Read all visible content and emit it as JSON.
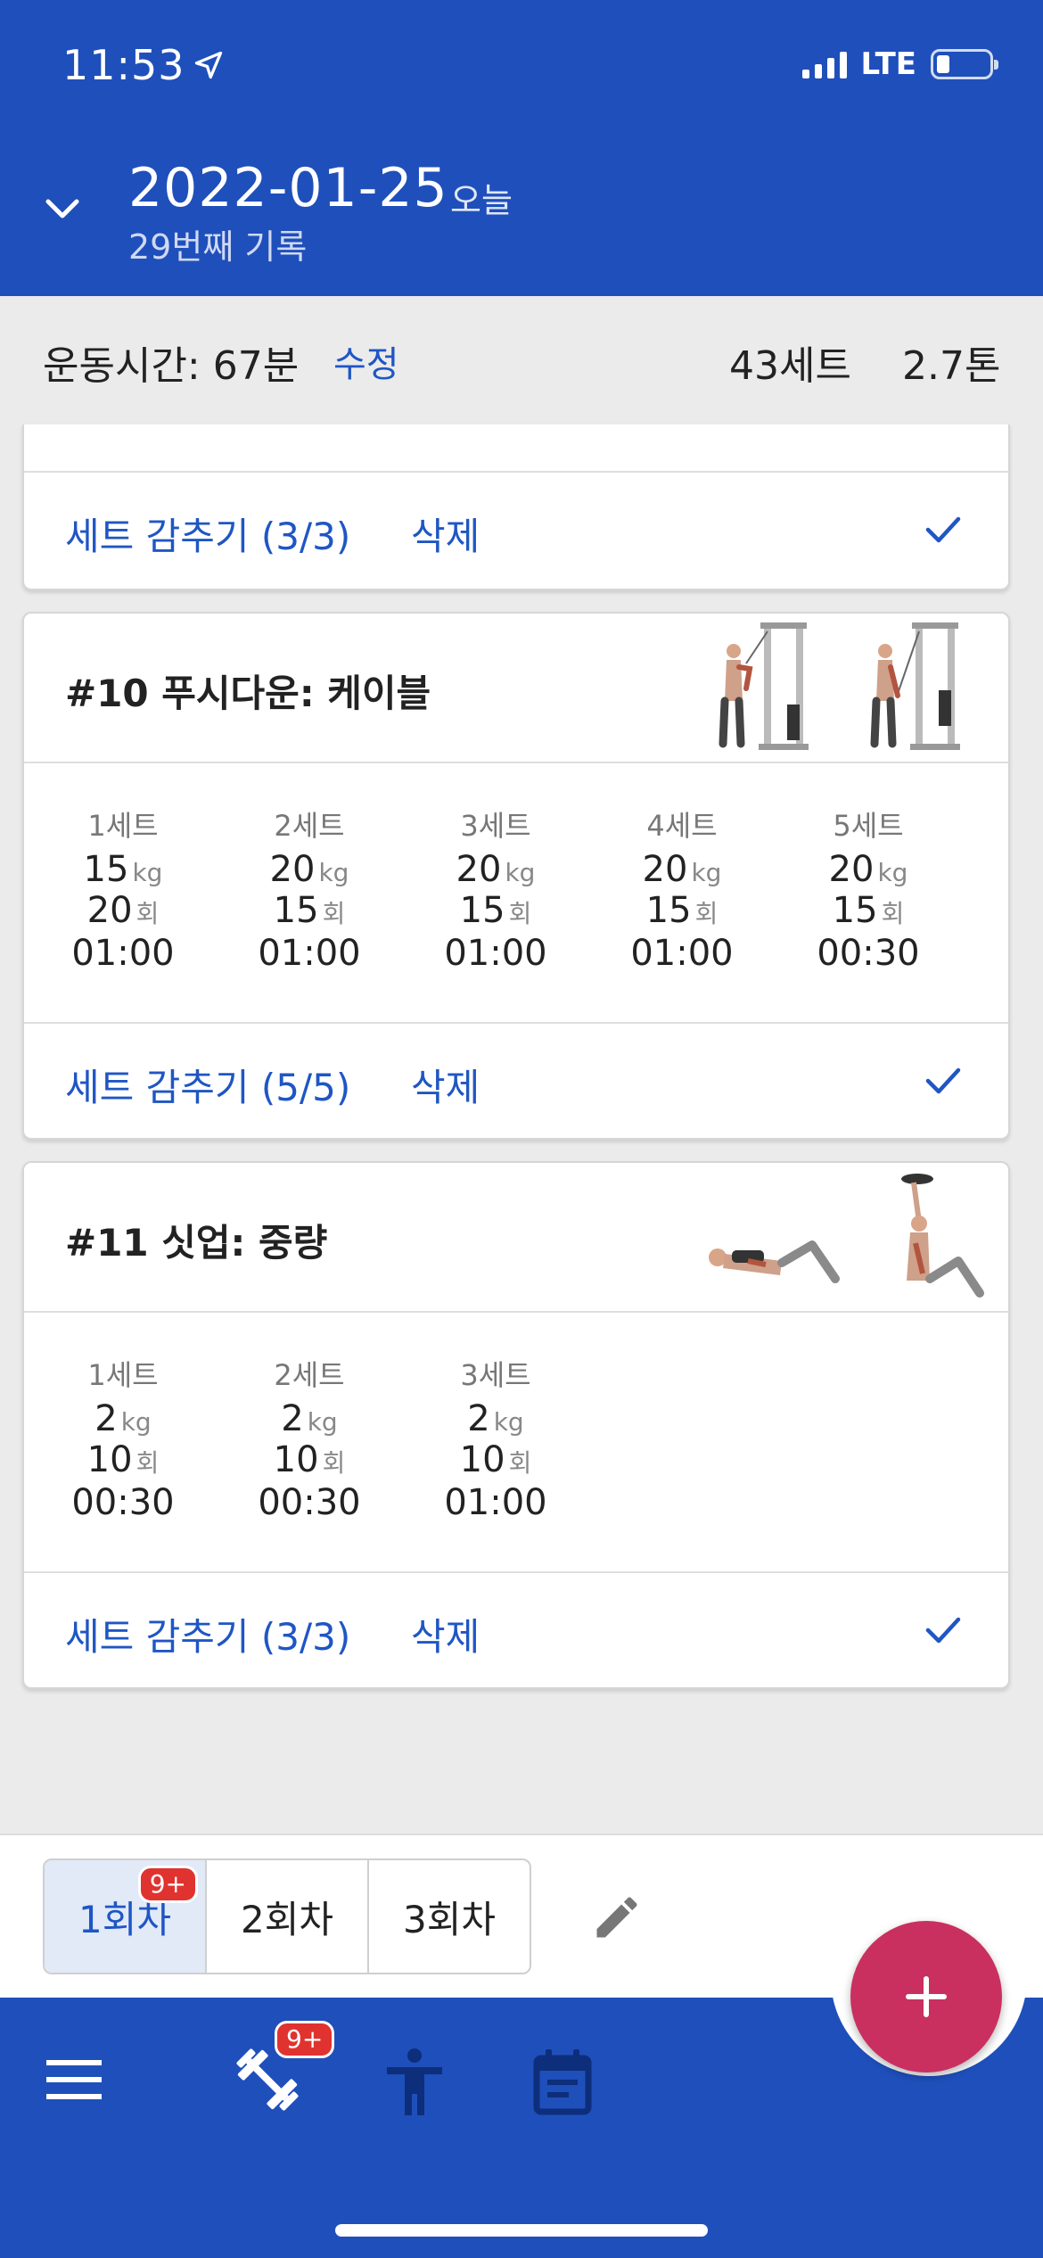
{
  "status": {
    "time": "11:53",
    "network": "LTE"
  },
  "header": {
    "date": "2022-01-25",
    "today_label": "오늘",
    "record_count": "29번째 기록"
  },
  "summary": {
    "time_label": "운동시간: 67분",
    "edit_label": "수정",
    "sets": "43세트",
    "tons": "2.7톤"
  },
  "partial_card": {
    "hide_label": "세트 감추기 (3/3)",
    "delete_label": "삭제"
  },
  "exercises": [
    {
      "title": "#10 푸시다운: 케이블",
      "hide_label": "세트 감추기 (5/5)",
      "delete_label": "삭제",
      "sets": [
        {
          "name": "1세트",
          "weight": "15",
          "weight_unit": "kg",
          "reps": "20",
          "reps_unit": "회",
          "time": "01:00"
        },
        {
          "name": "2세트",
          "weight": "20",
          "weight_unit": "kg",
          "reps": "15",
          "reps_unit": "회",
          "time": "01:00"
        },
        {
          "name": "3세트",
          "weight": "20",
          "weight_unit": "kg",
          "reps": "15",
          "reps_unit": "회",
          "time": "01:00"
        },
        {
          "name": "4세트",
          "weight": "20",
          "weight_unit": "kg",
          "reps": "15",
          "reps_unit": "회",
          "time": "01:00"
        },
        {
          "name": "5세트",
          "weight": "20",
          "weight_unit": "kg",
          "reps": "15",
          "reps_unit": "회",
          "time": "00:30"
        }
      ]
    },
    {
      "title": "#11 싯업: 중량",
      "hide_label": "세트 감추기 (3/3)",
      "delete_label": "삭제",
      "sets": [
        {
          "name": "1세트",
          "weight": "2",
          "weight_unit": "kg",
          "reps": "10",
          "reps_unit": "회",
          "time": "00:30"
        },
        {
          "name": "2세트",
          "weight": "2",
          "weight_unit": "kg",
          "reps": "10",
          "reps_unit": "회",
          "time": "00:30"
        },
        {
          "name": "3세트",
          "weight": "2",
          "weight_unit": "kg",
          "reps": "10",
          "reps_unit": "회",
          "time": "01:00"
        }
      ]
    }
  ],
  "sessions": {
    "tabs": [
      "1회차",
      "2회차",
      "3회차"
    ],
    "badge": "9+"
  },
  "nav": {
    "workout_badge": "9+"
  },
  "colors": {
    "primary": "#1f4fbb",
    "link": "#1f56c4",
    "fab": "#c9305f",
    "badge": "#e0332f"
  },
  "icons": [
    "location-arrow-icon",
    "chevron-down-icon",
    "check-icon",
    "pencil-icon",
    "plus-icon",
    "menu-icon",
    "dumbbell-icon",
    "body-icon",
    "calendar-icon"
  ]
}
